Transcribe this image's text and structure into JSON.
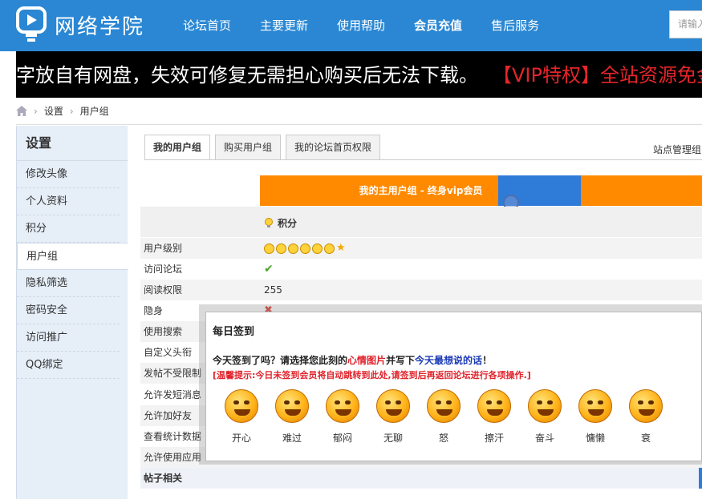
{
  "header": {
    "logo_text": "网络学院",
    "nav": [
      {
        "label": "论坛首页",
        "bold": false
      },
      {
        "label": "主要更新",
        "bold": false
      },
      {
        "label": "使用帮助",
        "bold": false
      },
      {
        "label": "会员充值",
        "bold": true
      },
      {
        "label": "售后服务",
        "bold": false
      }
    ],
    "search_placeholder": "请输入"
  },
  "marquee": {
    "white_text": "字放自有网盘，失效可修复无需担心购买后无法下载。",
    "red_text": "【VIP特权】全站资源免金币"
  },
  "breadcrumb": {
    "items": [
      "设置",
      "用户组"
    ]
  },
  "sidebar": {
    "title": "设置",
    "items": [
      {
        "label": "修改头像",
        "active": false
      },
      {
        "label": "个人资料",
        "active": false
      },
      {
        "label": "积分",
        "active": false
      },
      {
        "label": "用户组",
        "active": true
      },
      {
        "label": "隐私筛选",
        "active": false
      },
      {
        "label": "密码安全",
        "active": false
      },
      {
        "label": "访问推广",
        "active": false
      },
      {
        "label": "QQ绑定",
        "active": false
      }
    ]
  },
  "tabs": [
    {
      "label": "我的用户组",
      "active": true
    },
    {
      "label": "购买用户组",
      "active": false
    },
    {
      "label": "我的论坛首页权限",
      "active": false
    }
  ],
  "admin_link": "站点管理组",
  "group": {
    "title": "我的主用户组 - 终身vip会员",
    "score_label": "积分"
  },
  "permissions": [
    {
      "label": "用户级别",
      "type": "level",
      "smileys": 6,
      "stars": 1
    },
    {
      "label": "访问论坛",
      "type": "check"
    },
    {
      "label": "阅读权限",
      "type": "text",
      "value": "255"
    },
    {
      "label": "隐身",
      "type": "cross"
    },
    {
      "label": "使用搜索",
      "type": "none"
    },
    {
      "label": "自定义头衔",
      "type": "none"
    },
    {
      "label": "发帖不受限制",
      "type": "none"
    },
    {
      "label": "允许发短消息",
      "type": "none"
    },
    {
      "label": "允许加好友",
      "type": "none"
    },
    {
      "label": "查看统计数据",
      "type": "none"
    },
    {
      "label": "允许使用应用",
      "type": "none"
    }
  ],
  "section_label": "帖子相关",
  "dialog": {
    "title": "每日签到",
    "line1_a": "今天签到了吗？请选择您此刻的",
    "line1_red": "心情图片",
    "line1_b": "并写下",
    "line1_blue": "今天最想说的话",
    "line1_c": "！",
    "line2": "[温馨提示:今日未签到会员将自动跳转到此处,请签到后再返回论坛进行各项操作.]",
    "moods": [
      "开心",
      "难过",
      "郁闷",
      "无聊",
      "怒",
      "擦汗",
      "奋斗",
      "慵懒",
      "衰"
    ]
  }
}
